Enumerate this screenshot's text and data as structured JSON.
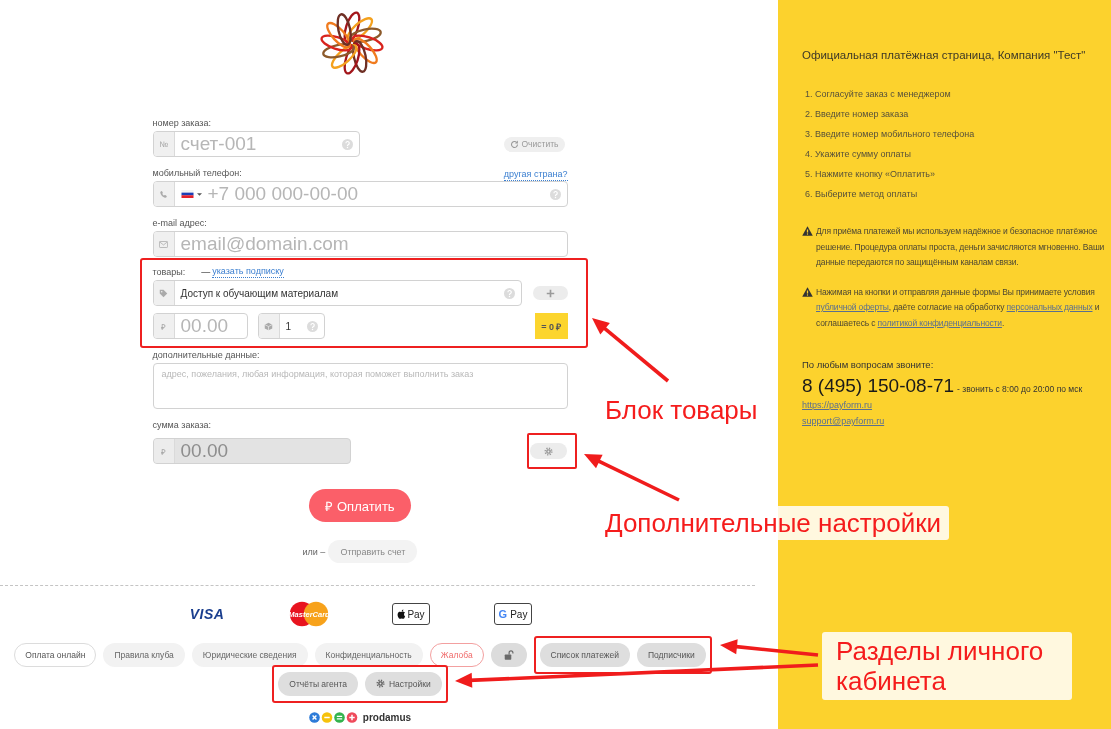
{
  "form": {
    "order_number": {
      "label": "номер заказа:",
      "prefix": "№",
      "placeholder": "счет-001",
      "clear_button": "Очистить"
    },
    "phone": {
      "label": "мобильный телефон:",
      "other_country_link": "другая страна?",
      "placeholder": "+7 000 000-00-00"
    },
    "email": {
      "label": "e-mail адрес:",
      "placeholder": "email@domain.com"
    },
    "products": {
      "highlighted": true,
      "label": "товары:",
      "link_dash": "—",
      "subscription_link": "указать подписку",
      "product_value": "Доступ к обучающим материалам",
      "price_prefix": "₽",
      "price_placeholder": "00.00",
      "quantity_value": "1",
      "total": "= 0 ₽"
    },
    "extra": {
      "label": "дополнительные данные:",
      "placeholder": "адрес, пожелания, любая информация, которая поможет выполнить заказ"
    },
    "sum": {
      "label": "сумма заказа:",
      "prefix": "₽",
      "placeholder": "00.00",
      "disabled": true,
      "settings_highlighted": true
    },
    "pay_button": "₽ Оплатить",
    "or_text": "или –",
    "invoice_button": "Отправить счет"
  },
  "payment_methods": [
    {
      "kind": "visa",
      "label": "VISA"
    },
    {
      "kind": "mastercard",
      "label": "MasterCard"
    },
    {
      "kind": "apple_pay",
      "label": "Pay"
    },
    {
      "kind": "google_pay",
      "mark": "G",
      "label": "Pay"
    }
  ],
  "footer": {
    "groups": [
      {
        "highlighted": false,
        "items": [
          {
            "kind": "link",
            "label": "Оплата онлайн",
            "selected": true
          },
          {
            "kind": "link",
            "label": "Правила клуба",
            "selected": false
          },
          {
            "kind": "link",
            "label": "Юридические сведения",
            "selected": false
          },
          {
            "kind": "link",
            "label": "Конфиденциальность",
            "selected": false
          },
          {
            "kind": "complaint",
            "label": "Жалоба",
            "selected": false
          },
          {
            "kind": "lock",
            "selected": false
          }
        ]
      },
      {
        "highlighted": true,
        "items": [
          {
            "kind": "cabinet",
            "label": "Список платежей",
            "selected": false
          },
          {
            "kind": "cabinet",
            "label": "Подписчики",
            "selected": false
          }
        ]
      },
      {
        "highlighted": true,
        "items": [
          {
            "kind": "cabinet",
            "label": "Отчёты агента",
            "selected": false
          },
          {
            "kind": "settings",
            "label": "Настройки",
            "selected": false
          }
        ]
      }
    ]
  },
  "brand": "prodamus",
  "info": {
    "title": "Официальная платёжная страница, Компания \"Тест\"",
    "steps": [
      {
        "number": "1.",
        "text": "Согласуйте заказ с менеджером"
      },
      {
        "number": "2.",
        "text": "Введите номер заказа"
      },
      {
        "number": "3.",
        "text": "Введите номер мобильного телефона"
      },
      {
        "number": "4.",
        "text": "Укажите сумму оплаты"
      },
      {
        "number": "5.",
        "text": "Нажмите кнопку «Оплатить»"
      },
      {
        "number": "6.",
        "text": "Выберите метод оплаты"
      }
    ],
    "notices": [
      {
        "parts": [
          {
            "kind": "text",
            "text": "Для приёма платежей мы используем надёжное и безопасное платёжное решение. Процедура оплаты проста, деньги зачисляются мгновенно. Ваши данные передаются по защищённым каналам связи."
          }
        ]
      },
      {
        "parts": [
          {
            "kind": "text",
            "text": "Нажимая на кнопки и отправляя данные формы Вы принимаете условия "
          },
          {
            "kind": "link",
            "text": "публичной оферты"
          },
          {
            "kind": "text",
            "text": ", даёте согласие на обработку "
          },
          {
            "kind": "link",
            "text": "персональных данных"
          },
          {
            "kind": "text",
            "text": " и соглашаетесь с "
          },
          {
            "kind": "link",
            "text": "политикой конфиденциальности"
          },
          {
            "kind": "text",
            "text": "."
          }
        ]
      }
    ],
    "contact_heading": "По любым вопросам звоните:",
    "phone": "8 (495) 150-08-71",
    "hours": "- звонить с 8:00 до 20:00 по мск",
    "links": [
      "https://payform.ru",
      "support@payform.ru"
    ]
  },
  "annotations": [
    {
      "text": "Блок товары"
    },
    {
      "text": "Дополнительные настройки"
    },
    {
      "text": "Разделы личного кабинета"
    }
  ]
}
